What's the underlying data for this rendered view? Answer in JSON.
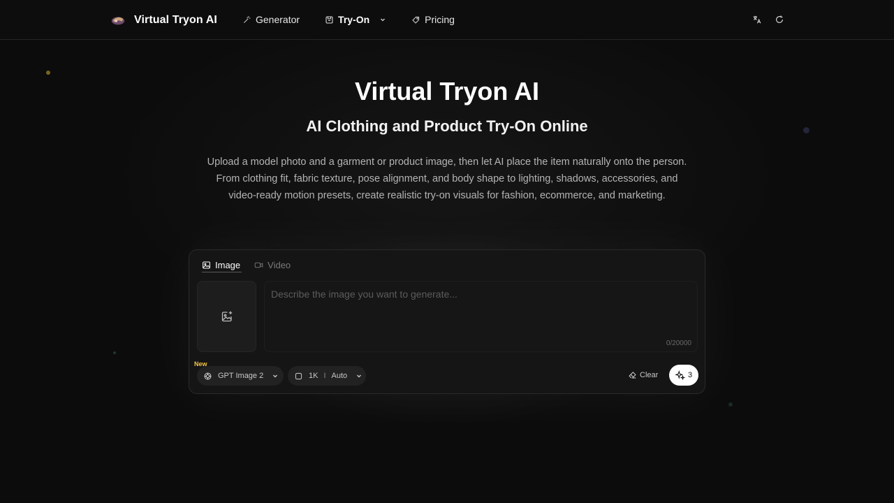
{
  "header": {
    "brand_name": "Virtual Tryon AI",
    "nav": [
      {
        "label": "Generator",
        "icon": "wand-icon"
      },
      {
        "label": "Try-On",
        "icon": "shirt-box-icon",
        "has_dropdown": true,
        "active": true
      },
      {
        "label": "Pricing",
        "icon": "tag-icon"
      }
    ],
    "right_icons": [
      "translate-icon",
      "refresh-icon"
    ]
  },
  "hero": {
    "title": "Virtual Tryon AI",
    "subtitle": "AI Clothing and Product Try-On Online",
    "description": "Upload a model photo and a garment or product image, then let AI place the item naturally onto the person. From clothing fit, fabric texture, pose alignment, and body shape to lighting, shadows, accessories, and video-ready motion presets, create realistic try-on visuals for fashion, ecommerce, and marketing."
  },
  "generator": {
    "tabs": [
      {
        "label": "Image",
        "active": true
      },
      {
        "label": "Video",
        "active": false
      }
    ],
    "prompt_placeholder": "Describe the image you want to generate...",
    "prompt_value": "",
    "char_counter": "0/20000",
    "new_badge": "New",
    "model_label": "GPT Image 2",
    "resolution_label": "1K",
    "separator": "I",
    "aspect_label": "Auto",
    "clear_label": "Clear",
    "credits": "3"
  },
  "colors": {
    "background": "#0c0c0c",
    "card": "#151515",
    "accent_new": "#f5c542",
    "generate_button": "#ffffff"
  }
}
